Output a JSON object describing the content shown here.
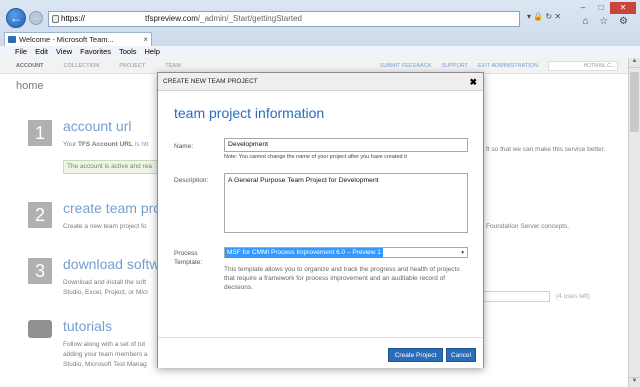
{
  "browser": {
    "url_prefix": "https://",
    "url_host": "tfspreview.com",
    "url_path": "/_admin/_Start/gettingStarted",
    "tab_title": "Welcome - Microsoft Team...",
    "back_symbol": "←",
    "forward_symbol": "→",
    "window_controls": [
      "–",
      "□",
      "✕"
    ],
    "addr_icons": "▾ 🔒 ↻ ✕",
    "toolbar_icons": "⌂ ☆ ⚙",
    "menu": [
      "File",
      "Edit",
      "View",
      "Favorites",
      "Tools",
      "Help"
    ]
  },
  "topnav": {
    "left": [
      "ACCOUNT",
      "COLLECTION",
      "PROJECT",
      "TEAM"
    ],
    "right": [
      "SUBMIT FEEDBACK",
      "SUPPORT",
      "EXIT ADMINISTRATION"
    ],
    "account_suffix": "HOTMAIL.C..."
  },
  "page": {
    "heading": "home",
    "steps": [
      {
        "num": "1",
        "title": "account url",
        "body_prefix": "Your ",
        "body_bold": "TFS Account URL",
        "body_suffix": " is htt",
        "green": "The account is active and rea"
      },
      {
        "num": "2",
        "title": "create team proj",
        "body": "Create a new team project fo"
      },
      {
        "num": "3",
        "title": "download softw",
        "body1": "Download and install the soft",
        "body2": "Studio, Excel, Project, or Micr"
      },
      {
        "title": "tutorials",
        "body1": "Follow along with a set of tut",
        "body2": "adding your team members a",
        "body3": "Studio, Microsoft Test Manag"
      }
    ],
    "right_fragments": {
      "f1": "ft so that we can make this service better.",
      "f2": "Foundation Server concepts.",
      "uses_left": "(4 uses left)"
    }
  },
  "modal": {
    "header": "CREATE NEW TEAM PROJECT",
    "close": "✖",
    "title": "team project information",
    "name_label": "Name:",
    "name_value": "Development",
    "name_note": "Note: You cannot change the name of your project after you have created it",
    "description_label": "Description:",
    "description_value": "A General Purpose Team Project for Development",
    "process_label": "Process Template:",
    "process_value": "MSF for CMMI Process Improvement 6.0 – Preview 1",
    "process_caret": "▾",
    "process_description": "This template allows you to organize and track the progress and health of projects that require a framework for process improvement and an auditable record of decisions.",
    "create_button": "Create Project",
    "cancel_button": "Cancel"
  },
  "colors": {
    "accent": "#2b6cb7",
    "selection": "#3399ff"
  }
}
